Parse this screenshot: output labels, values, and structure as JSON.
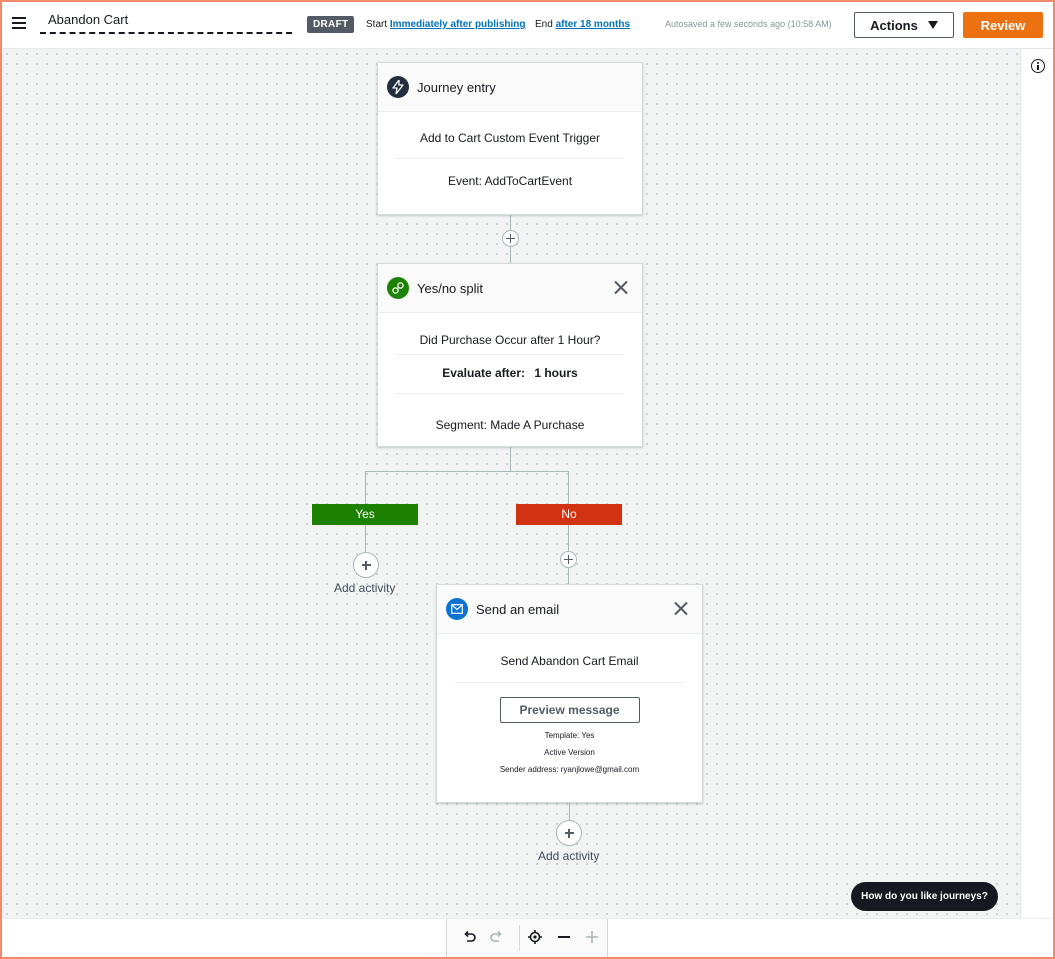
{
  "header": {
    "journey_name": "Abandon Cart",
    "status_badge": "DRAFT",
    "start_label": "Start",
    "start_value": "Immediately after publishing",
    "end_label": "End",
    "end_value": "after 18 months",
    "autosave_text": "Autosaved a few seconds ago (10:58 AM)",
    "actions_label": "Actions",
    "review_label": "Review"
  },
  "entry": {
    "title": "Journey entry",
    "trigger": "Add to Cart Custom Event Trigger",
    "event": "Event: AddToCartEvent"
  },
  "split": {
    "title": "Yes/no split",
    "question": "Did Purchase Occur after 1 Hour?",
    "evaluate_label": "Evaluate after:",
    "evaluate_value": "1 hours",
    "segment": "Segment: Made A Purchase",
    "yes_label": "Yes",
    "no_label": "No",
    "yes_color": "#1d8102",
    "no_color": "#d13212"
  },
  "email": {
    "title": "Send an email",
    "name": "Send Abandon Cart Email",
    "preview_label": "Preview message",
    "template": "Template: Yes",
    "version": "Active Version",
    "sender": "Sender address: ryanjlowe@gmail.com"
  },
  "add_activity_label": "Add activity",
  "feedback_label": "How do you like journeys?",
  "icons": {
    "menu": "hamburger-icon",
    "entry": "lightning-icon",
    "split": "split-icon",
    "email": "envelope-icon",
    "info": "info-icon"
  }
}
